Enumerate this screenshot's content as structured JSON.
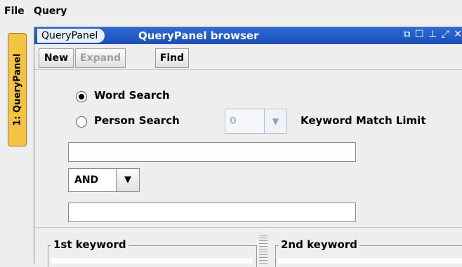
{
  "menubar": {
    "items": [
      "File",
      "Query"
    ]
  },
  "side_tab": {
    "label": "1: QueryPanel"
  },
  "panel": {
    "tab_label": "QueryPanel",
    "title": "QueryPanel browser",
    "window_icons": [
      "restore-icon",
      "maximize-icon",
      "pin-icon",
      "float-icon",
      "close-icon"
    ]
  },
  "toolbar": {
    "new_label": "New",
    "expand_label": "Expand",
    "find_label": "Find"
  },
  "search": {
    "word_search_label": "Word Search",
    "person_search_label": "Person Search",
    "selected": "Word Search",
    "match_limit_value": "0",
    "match_limit_label": "Keyword Match Limit",
    "keyword1_value": "",
    "operator": "AND",
    "keyword2_value": ""
  },
  "groups": {
    "first": "1st keyword",
    "second": "2nd keyword"
  }
}
